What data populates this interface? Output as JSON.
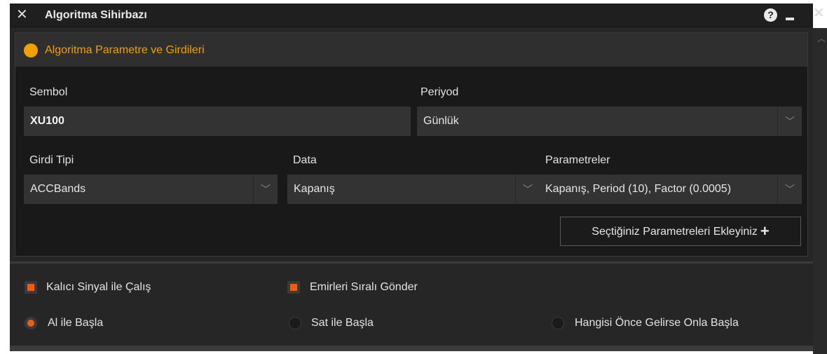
{
  "window": {
    "title": "Algoritma Sihirbazı",
    "help_glyph": "?"
  },
  "panel": {
    "title": "Algoritma Parametre ve Girdileri",
    "accent_color": "#f0a000"
  },
  "form": {
    "symbol_label": "Sembol",
    "symbol_value": "XU100",
    "period_label": "Periyod",
    "period_value": "Günlük",
    "input_type_label": "Girdi Tipi",
    "input_type_value": "ACCBands",
    "data_label": "Data",
    "data_value": "Kapanış",
    "params_label": "Parametreler",
    "params_value": "Kapanış, Period (10), Factor (0.0005)",
    "add_button_label": "Seçtiğiniz Parametreleri Ekleyiniz"
  },
  "options": {
    "persistent_signal": {
      "label": "Kalıcı Sinyal ile Çalış",
      "checked": true
    },
    "sequential_orders": {
      "label": "Emirleri Sıralı Gönder",
      "checked": true
    },
    "start_buy": {
      "label": "Al ile Başla",
      "selected": true
    },
    "start_sell": {
      "label": "Sat ile Başla",
      "selected": false
    },
    "start_first": {
      "label": "Hangisi Önce Gelirse Onla Başla",
      "selected": false
    }
  },
  "colors": {
    "toggle_on": "#ef5c12"
  }
}
